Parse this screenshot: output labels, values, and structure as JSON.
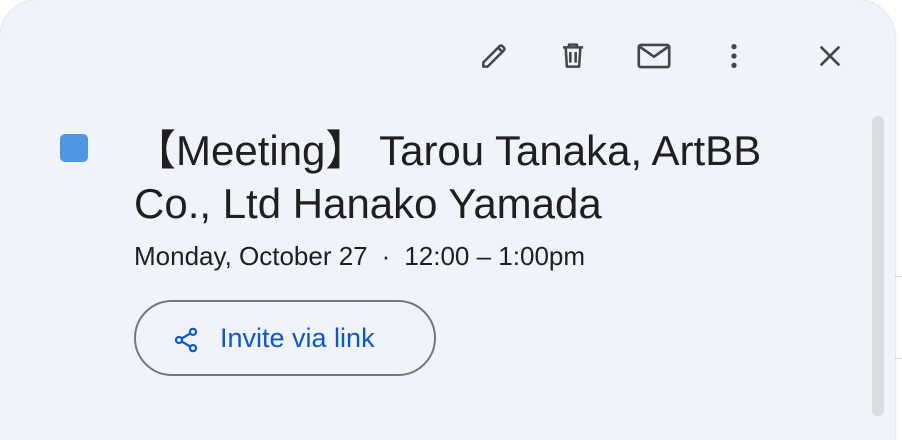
{
  "event": {
    "title": "【Meeting】 Tarou Tanaka, ArtBB Co., Ltd Hanako Yamada",
    "date": "Monday, October 27",
    "separator": "·",
    "time": "12:00 – 1:00pm",
    "color": "#4e97e2"
  },
  "toolbar": {
    "icons": [
      "pencil-icon",
      "trash-icon",
      "envelope-icon",
      "more-vert-icon",
      "close-icon"
    ]
  },
  "actions": {
    "invite_label": "Invite via link",
    "invite_icon": "share-icon",
    "accent_color": "#0b57d0"
  }
}
